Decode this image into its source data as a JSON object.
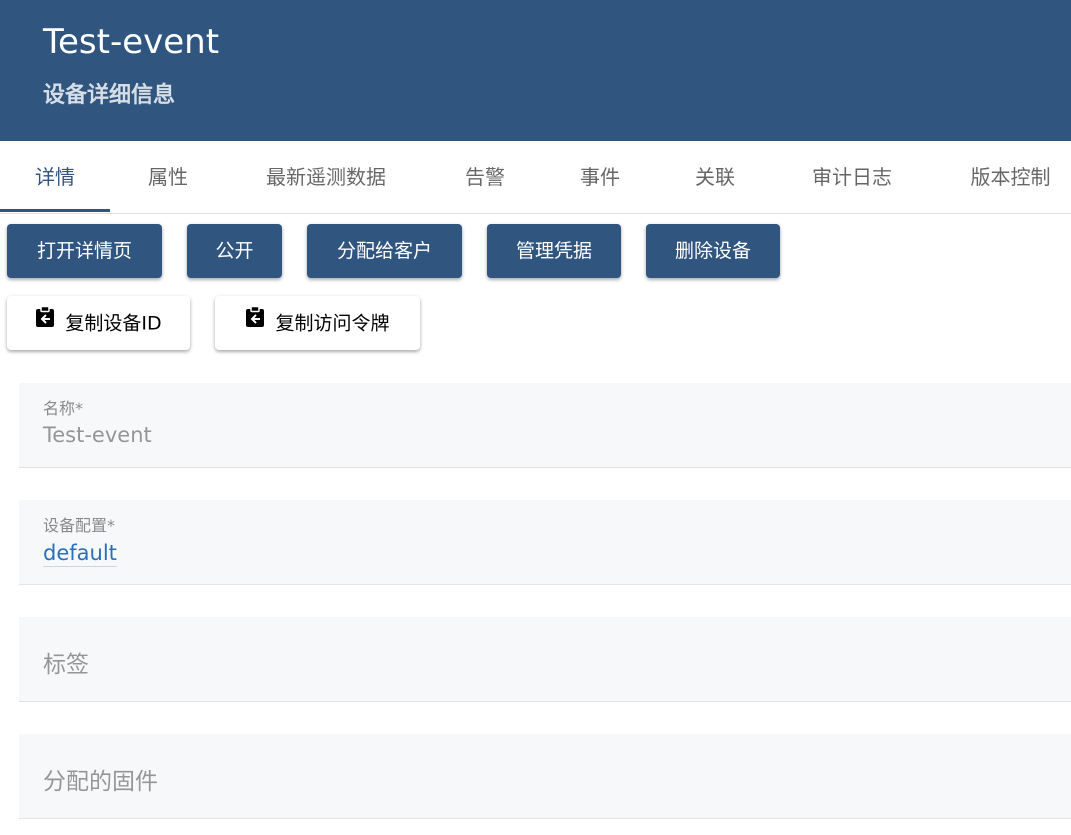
{
  "header": {
    "title": "Test-event",
    "subtitle": "设备详细信息"
  },
  "tabs": [
    {
      "label": "详情",
      "active": true
    },
    {
      "label": "属性"
    },
    {
      "label": "最新遥测数据"
    },
    {
      "label": "告警"
    },
    {
      "label": "事件"
    },
    {
      "label": "关联"
    },
    {
      "label": "审计日志"
    },
    {
      "label": "版本控制"
    }
  ],
  "actions": {
    "primary": [
      {
        "label": "打开详情页"
      },
      {
        "label": "公开"
      },
      {
        "label": "分配给客户"
      },
      {
        "label": "管理凭据"
      },
      {
        "label": "删除设备"
      }
    ],
    "copy": [
      {
        "label": "复制设备ID",
        "icon": "clipboard-copy-icon"
      },
      {
        "label": "复制访问令牌",
        "icon": "clipboard-copy-icon"
      }
    ]
  },
  "form": {
    "name": {
      "label": "名称*",
      "value": "Test-event"
    },
    "device_profile": {
      "label": "设备配置*",
      "value": "default"
    },
    "label": {
      "placeholder": "标签"
    },
    "firmware": {
      "placeholder": "分配的固件"
    }
  },
  "colors": {
    "primary": "#305680",
    "link": "#2a70b8",
    "field_bg": "#f7f8fa"
  }
}
